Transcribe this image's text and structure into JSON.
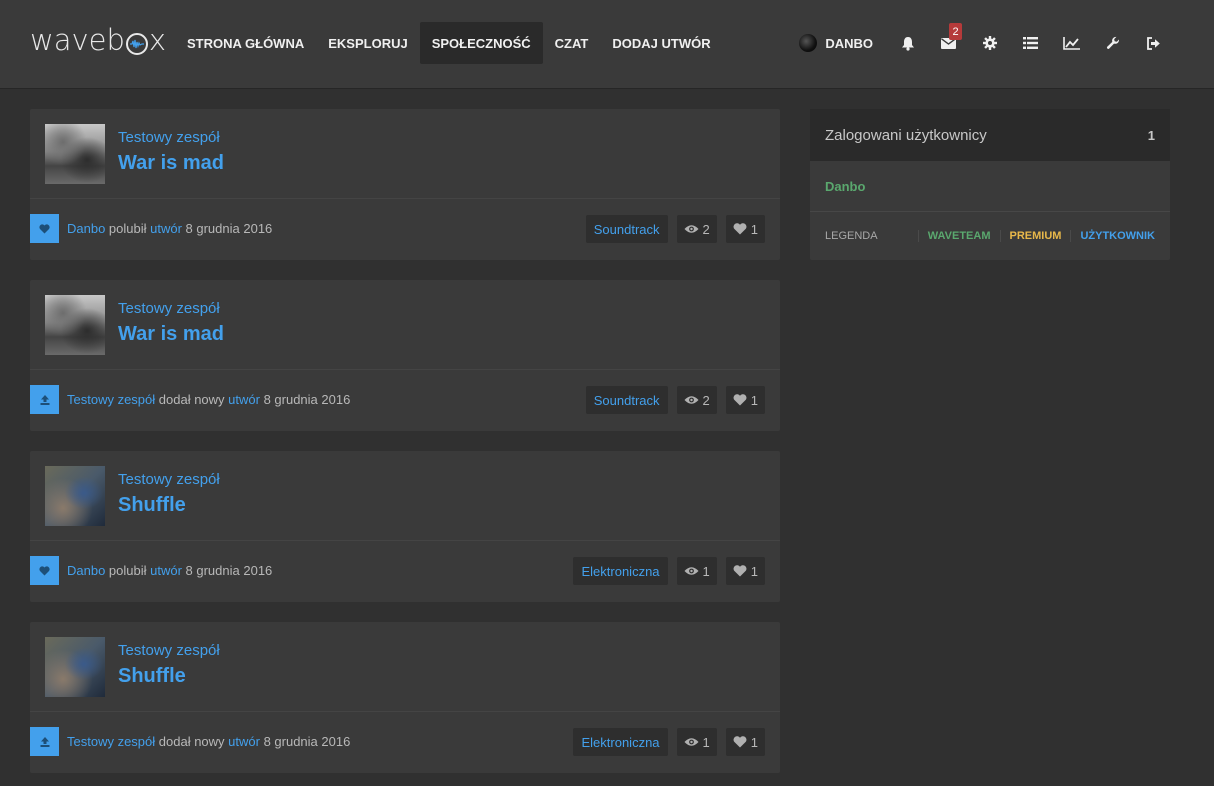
{
  "nav": {
    "logo": "wavebox",
    "links": [
      {
        "label": "STRONA GŁÓWNA"
      },
      {
        "label": "EKSPLORUJ"
      },
      {
        "label": "SPOŁECZNOŚĆ"
      },
      {
        "label": "CZAT"
      },
      {
        "label": "DODAJ UTWÓR"
      }
    ],
    "user": "DANBO",
    "messages_badge": "2",
    "icons": [
      "bell-icon",
      "envelope-icon",
      "gear-icon",
      "list-icon",
      "chart-line-icon",
      "wrench-icon",
      "sign-out-icon"
    ]
  },
  "feed": [
    {
      "artist": "Testowy zespół",
      "title": "War is mad",
      "action_icon": "heart-icon",
      "actor": "Danbo",
      "action_text": " polubił ",
      "object": "utwór",
      "date": " 8 grudnia 2016",
      "genre": "Soundtrack",
      "views": "2",
      "likes": "1"
    },
    {
      "artist": "Testowy zespół",
      "title": "War is mad",
      "action_icon": "upload-icon",
      "actor": "Testowy zespół",
      "action_text": " dodał nowy ",
      "object": "utwór",
      "date": " 8 grudnia 2016",
      "genre": "Soundtrack",
      "views": "2",
      "likes": "1"
    },
    {
      "artist": "Testowy zespół",
      "title": "Shuffle",
      "action_icon": "heart-icon",
      "actor": "Danbo",
      "action_text": " polubił ",
      "object": "utwór",
      "date": " 8 grudnia 2016",
      "genre": "Elektroniczna",
      "views": "1",
      "likes": "1"
    },
    {
      "artist": "Testowy zespół",
      "title": "Shuffle",
      "action_icon": "upload-icon",
      "actor": "Testowy zespół",
      "action_text": " dodał nowy ",
      "object": "utwór",
      "date": " 8 grudnia 2016",
      "genre": "Elektroniczna",
      "views": "1",
      "likes": "1"
    }
  ],
  "sidebar": {
    "title": "Zalogowani użytkownicy",
    "count": "1",
    "users": [
      "Danbo"
    ],
    "legend_label": "LEGENDA",
    "legend": [
      {
        "label": "WAVETEAM",
        "color": "#5aa86e"
      },
      {
        "label": "PREMIUM",
        "color": "#e8b84a"
      },
      {
        "label": "UŻYTKOWNIK",
        "color": "#43a0ec"
      }
    ]
  },
  "colors": {
    "accent": "#43a0ec",
    "background": "#303030",
    "panel": "#3a3a3a",
    "badge": "#b53a3a"
  }
}
